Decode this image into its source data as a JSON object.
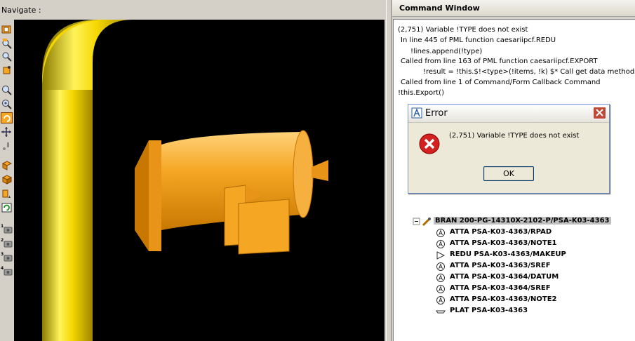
{
  "navigate_label": "Navigate :",
  "command_window": {
    "title": "Command Window",
    "lines": [
      "(2,751)   Variable !TYPE does not exist",
      "In line 445 of PML function caesariipcf.REDU",
      "!lines.append(!type)",
      "Called from line 163 of PML function caesariipcf.EXPORT",
      "!result = !this.$!<type>(!items, !k)  $* Call get data methods",
      "Called from line 1 of Command/Form Callback Command",
      "!this.Export()"
    ]
  },
  "error_dialog": {
    "title": "Error",
    "message": "(2,751)  Variable !TYPE does not exist",
    "ok_label": "OK"
  },
  "tree": {
    "root": "BRAN 200-PG-14310X-2102-P/PSA-K03-4363",
    "items": [
      "ATTA PSA-K03-4363/RPAD",
      "ATTA PSA-K03-4363/NOTE1",
      "REDU PSA-K03-4363/MAKEUP",
      "ATTA PSA-K03-4363/SREF",
      "ATTA PSA-K03-4364/DATUM",
      "ATTA PSA-K03-4364/SREF",
      "ATTA PSA-K03-4363/NOTE2",
      "PLAT PSA-K03-4363"
    ]
  },
  "toolbar_tools": [
    "zoom-window-icon",
    "zoom-in-icon",
    "zoom-out-icon",
    "walk-icon",
    "magnify-icon",
    "magnify-plus-icon",
    "rotate-icon",
    "pan-icon",
    "move-icon",
    "view-direction-icon",
    "view-iso-icon",
    "view-plan-icon",
    "refresh-icon",
    "camera-1-icon",
    "camera-2-icon",
    "camera-3-icon",
    "camera-4-icon"
  ],
  "toolbar_camera_numbers": [
    "1",
    "2",
    "3",
    "4"
  ],
  "colors": {
    "pipe_yellow": "#f5d700",
    "component_orange": "#f5a623",
    "error_red": "#d32020"
  }
}
